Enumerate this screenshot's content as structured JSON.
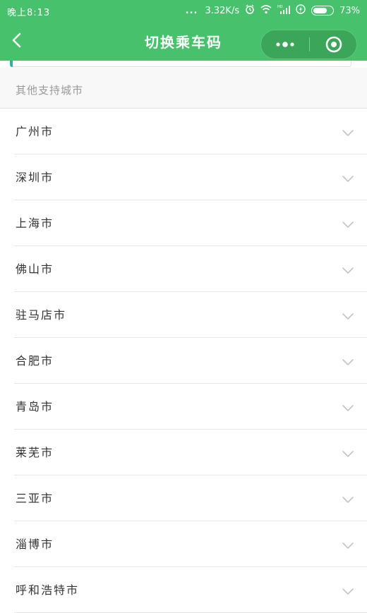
{
  "status_bar": {
    "time": "晚上8:13",
    "dots": "...",
    "speed": "3.32K/s",
    "alarm_icon": "alarm-icon",
    "wifi_icon": "wifi-icon",
    "signal_icon": "signal-hd-icon",
    "charging_icon": "charging-icon",
    "battery_percent": "73%",
    "battery_level": 0.73
  },
  "navbar": {
    "title": "切换乘车码",
    "back_icon": "back-arrow-icon",
    "more_icon": "more-dots-icon",
    "close_icon": "close-miniprogram-icon"
  },
  "section": {
    "header": "其他支持城市"
  },
  "cities": [
    {
      "name": "广州市"
    },
    {
      "name": "深圳市"
    },
    {
      "name": "上海市"
    },
    {
      "name": "佛山市"
    },
    {
      "name": "驻马店市"
    },
    {
      "name": "合肥市"
    },
    {
      "name": "青岛市"
    },
    {
      "name": "莱芜市"
    },
    {
      "name": "三亚市"
    },
    {
      "name": "淄博市"
    },
    {
      "name": "呼和浩特市"
    }
  ],
  "colors": {
    "brand_green": "#47c16b",
    "capsule_green": "#3ba55a",
    "accent_teal": "#2bb3a3"
  }
}
